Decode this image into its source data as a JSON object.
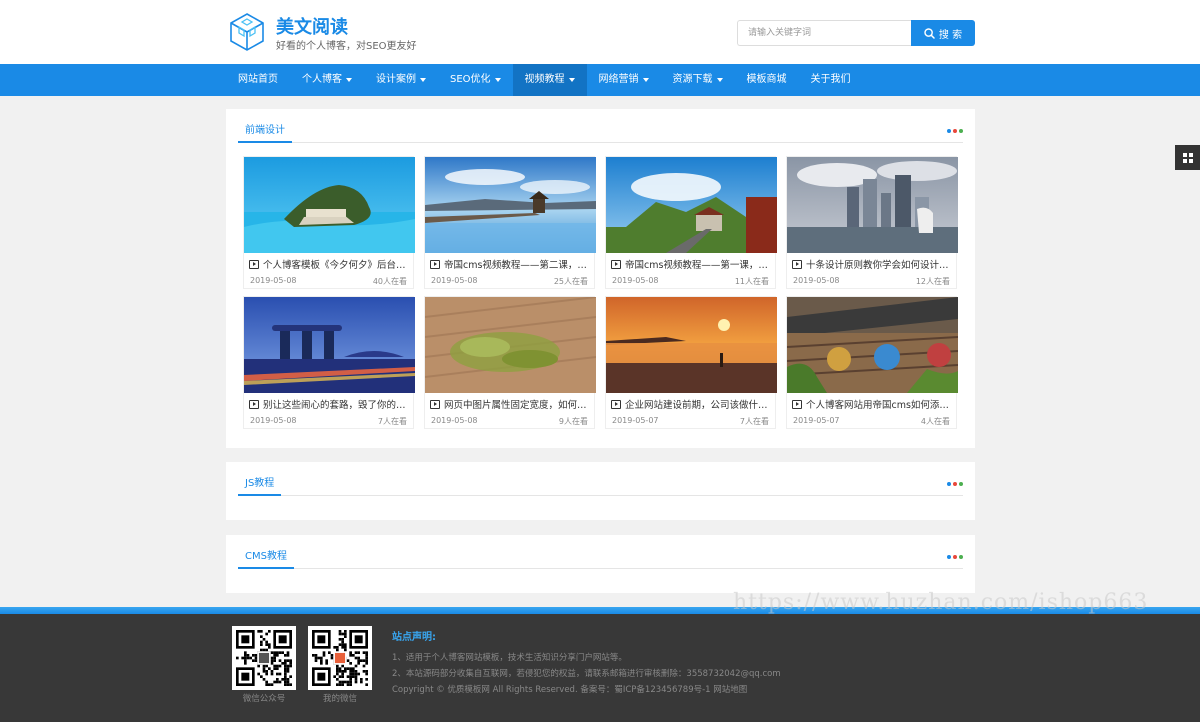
{
  "header": {
    "site_title": "美文阅读",
    "site_subtitle": "好看的个人博客，对SEO更友好",
    "search_placeholder": "请输入关键字词",
    "search_button": "搜 索"
  },
  "nav": {
    "items": [
      {
        "label": "网站首页",
        "dropdown": false,
        "active": false
      },
      {
        "label": "个人博客",
        "dropdown": true,
        "active": false
      },
      {
        "label": "设计案例",
        "dropdown": true,
        "active": false
      },
      {
        "label": "SEO优化",
        "dropdown": true,
        "active": false
      },
      {
        "label": "视频教程",
        "dropdown": true,
        "active": true
      },
      {
        "label": "网络营销",
        "dropdown": true,
        "active": false
      },
      {
        "label": "资源下载",
        "dropdown": true,
        "active": false
      },
      {
        "label": "模板商城",
        "dropdown": false,
        "active": false
      },
      {
        "label": "关于我们",
        "dropdown": false,
        "active": false
      }
    ]
  },
  "sections": [
    {
      "title": "前端设计",
      "cards": [
        {
          "title": "个人博客模板《今夕何夕》后台…",
          "date": "2019-05-08",
          "views": "40人在看",
          "image": "lake-island"
        },
        {
          "title": "帝国cms视频教程——第二课，…",
          "date": "2019-05-08",
          "views": "25人在看",
          "image": "pier-pavilion"
        },
        {
          "title": "帝国cms视频教程——第一课，…",
          "date": "2019-05-08",
          "views": "11人在看",
          "image": "railway-station"
        },
        {
          "title": "十条设计原则教你学会如何设计…",
          "date": "2019-05-08",
          "views": "12人在看",
          "image": "singapore-merlion"
        },
        {
          "title": "别让这些闹心的套路，毁了你的…",
          "date": "2019-05-08",
          "views": "7人在看",
          "image": "marina-bay-night"
        },
        {
          "title": "网页中图片属性固定宽度，如何…",
          "date": "2019-05-08",
          "views": "9人在看",
          "image": "tea-leaves"
        },
        {
          "title": "企业网站建设前期，公司该做什…",
          "date": "2019-05-07",
          "views": "7人在看",
          "image": "sunset-beach"
        },
        {
          "title": "个人博客网站用帝国cms如何添…",
          "date": "2019-05-07",
          "views": "4人在看",
          "image": "wooden-house"
        }
      ]
    },
    {
      "title": "JS教程",
      "cards": []
    },
    {
      "title": "CMS教程",
      "cards": []
    }
  ],
  "footer": {
    "qr_codes": [
      {
        "label": "微信公众号"
      },
      {
        "label": "我的微信"
      }
    ],
    "notice_title": "站点声明:",
    "lines": [
      "1、适用于个人博客网站模板，技术生活知识分享门户网站等。",
      "2、本站源码部分收集自互联网，若侵犯您的权益，请联系邮箱进行审核删除：3558732042@qq.com",
      "Copyright © 优质模板网 All Rights Reserved. 备案号：蜀ICP备123456789号-1 网站地图"
    ]
  },
  "watermark": "https://www.huzhan.com/ishop663",
  "colors": {
    "accent": "#1a8ae6",
    "nav_active": "#1273c4",
    "footer_bg": "#383838",
    "dot_1": "#1a8ae6",
    "dot_2": "#e8473b",
    "dot_3": "#4caf50"
  }
}
